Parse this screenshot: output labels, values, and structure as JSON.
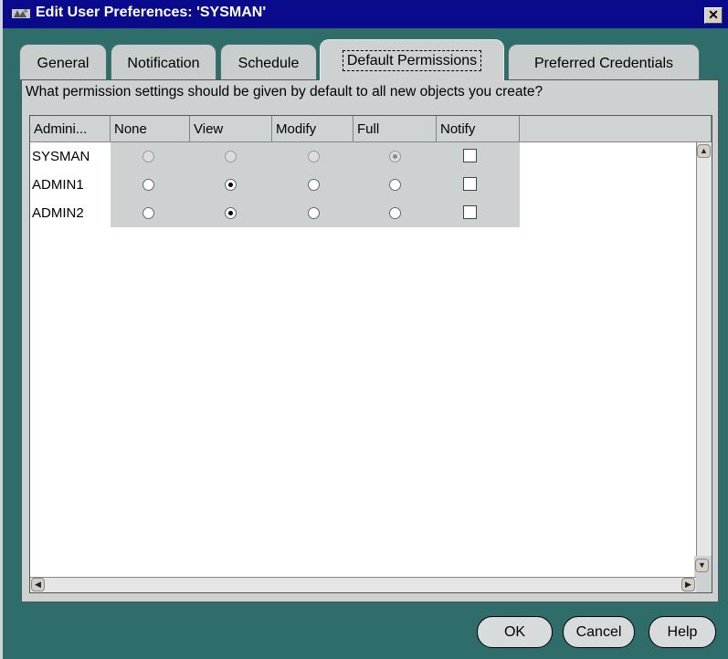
{
  "window": {
    "title": "Edit User Preferences: 'SYSMAN'",
    "close_label": "✕"
  },
  "tabs": [
    {
      "label": "General"
    },
    {
      "label": "Notification"
    },
    {
      "label": "Schedule"
    },
    {
      "label": "Default Permissions",
      "active": true
    },
    {
      "label": "Preferred Credentials"
    }
  ],
  "question": "What permission settings should be given by default to all new objects you create?",
  "table": {
    "columns": [
      "Admini...",
      "None",
      "View",
      "Modify",
      "Full",
      "Notify"
    ],
    "rows": [
      {
        "name": "SYSMAN",
        "selected": "Full",
        "notify": false,
        "disabled": true
      },
      {
        "name": "ADMIN1",
        "selected": "View",
        "notify": false,
        "disabled": false
      },
      {
        "name": "ADMIN2",
        "selected": "View",
        "notify": false,
        "disabled": false
      }
    ]
  },
  "buttons": {
    "ok": "OK",
    "cancel": "Cancel",
    "help": "Help"
  },
  "colors": {
    "background": "#2f6d6b",
    "titlebar": "#0a0a8c",
    "panel": "#cdd1d1"
  }
}
